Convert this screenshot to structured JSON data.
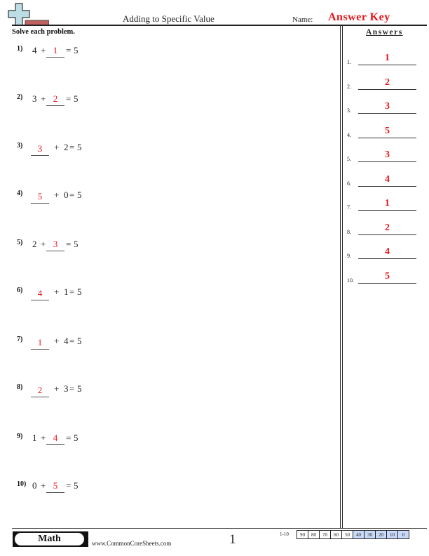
{
  "header": {
    "logo_icon": "plus-sign-on-bar-logo",
    "title": "Adding to Specific Value",
    "name_label": "Name:",
    "name_value": "Answer Key"
  },
  "instructions": "Solve each problem.",
  "problems": [
    {
      "num": "1)",
      "layout": "a_blank",
      "known": "4",
      "answer": "1",
      "sum": "5"
    },
    {
      "num": "2)",
      "layout": "a_blank",
      "known": "3",
      "answer": "2",
      "sum": "5"
    },
    {
      "num": "3)",
      "layout": "blank_b",
      "known": "2",
      "answer": "3",
      "sum": "5"
    },
    {
      "num": "4)",
      "layout": "blank_b",
      "known": "0",
      "answer": "5",
      "sum": "5"
    },
    {
      "num": "5)",
      "layout": "a_blank",
      "known": "2",
      "answer": "3",
      "sum": "5"
    },
    {
      "num": "6)",
      "layout": "blank_b",
      "known": "1",
      "answer": "4",
      "sum": "5"
    },
    {
      "num": "7)",
      "layout": "blank_b",
      "known": "4",
      "answer": "1",
      "sum": "5"
    },
    {
      "num": "8)",
      "layout": "blank_b",
      "known": "3",
      "answer": "2",
      "sum": "5"
    },
    {
      "num": "9)",
      "layout": "a_blank",
      "known": "1",
      "answer": "4",
      "sum": "5"
    },
    {
      "num": "10)",
      "layout": "a_blank",
      "known": "0",
      "answer": "5",
      "sum": "5"
    }
  ],
  "answers_panel": {
    "heading": "Answers",
    "items": [
      {
        "num": "1.",
        "value": "1"
      },
      {
        "num": "2.",
        "value": "2"
      },
      {
        "num": "3.",
        "value": "3"
      },
      {
        "num": "4.",
        "value": "5"
      },
      {
        "num": "5.",
        "value": "3"
      },
      {
        "num": "6.",
        "value": "4"
      },
      {
        "num": "7.",
        "value": "1"
      },
      {
        "num": "8.",
        "value": "2"
      },
      {
        "num": "9.",
        "value": "4"
      },
      {
        "num": "10.",
        "value": "5"
      }
    ]
  },
  "footer": {
    "subject": "Math",
    "website": "www.CommonCoreSheets.com",
    "page_number": "1",
    "score_label": "1-10",
    "scores": [
      "90",
      "80",
      "70",
      "60",
      "50",
      "40",
      "30",
      "20",
      "10",
      "0"
    ],
    "low_score_highlight": "#c9daf8"
  },
  "colors": {
    "answer_red": "#e8161b",
    "ink": "#222222"
  }
}
